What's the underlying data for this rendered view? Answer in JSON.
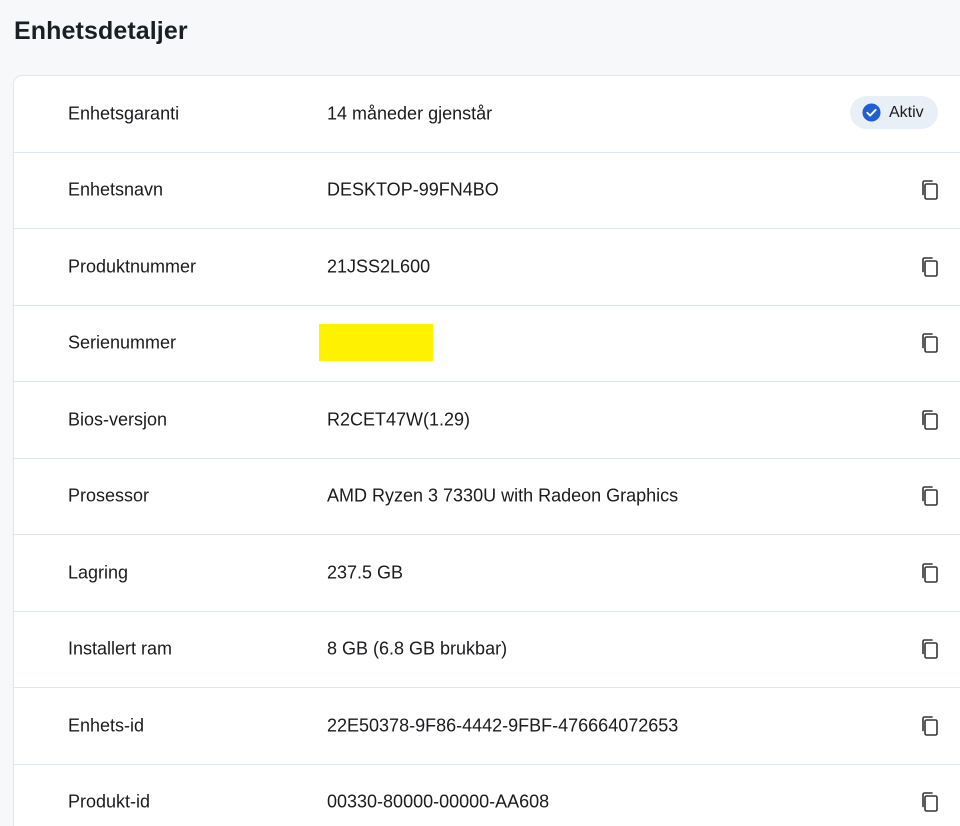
{
  "page": {
    "title": "Enhetsdetaljer"
  },
  "colors": {
    "badge_check": "#1f5fd1",
    "badge_bg": "#e9eff6",
    "redaction": "#fff200"
  },
  "warranty": {
    "label": "Enhetsgaranti",
    "value": "14 måneder gjenstår",
    "status_badge": "Aktiv",
    "status_icon": "check-circle-icon"
  },
  "rows": [
    {
      "label": "Enhetsnavn",
      "value": "DESKTOP-99FN4BO",
      "icon": "copy-icon"
    },
    {
      "label": "Produktnummer",
      "value": "21JSS2L600",
      "icon": "copy-icon"
    },
    {
      "label": "Serienummer",
      "value": "",
      "icon": "copy-icon"
    },
    {
      "label": "Bios-versjon",
      "value": "R2CET47W(1.29)",
      "icon": "copy-icon"
    },
    {
      "label": "Prosessor",
      "value": "AMD Ryzen 3 7330U with Radeon Graphics",
      "icon": "copy-icon"
    },
    {
      "label": "Lagring",
      "value": "237.5 GB",
      "icon": "copy-icon"
    },
    {
      "label": "Installert ram",
      "value": "8 GB (6.8 GB brukbar)",
      "icon": "copy-icon"
    },
    {
      "label": "Enhets-id",
      "value": "22E50378-9F86-4442-9FBF-476664072653",
      "icon": "copy-icon"
    },
    {
      "label": "Produkt-id",
      "value": "00330-80000-00000-AA608",
      "icon": "copy-icon"
    }
  ]
}
